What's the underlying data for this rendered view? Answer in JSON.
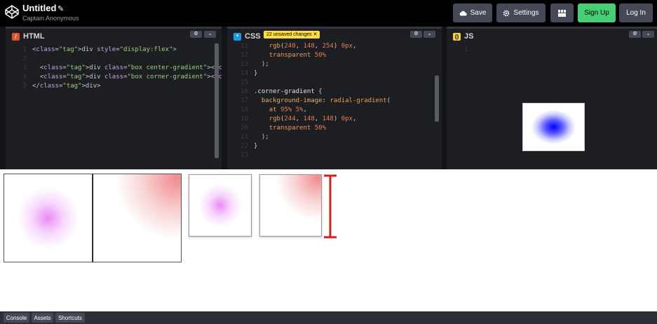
{
  "header": {
    "title": "Untitled",
    "subtitle": "Captain Anonymous",
    "buttons": {
      "save": "Save",
      "settings": "Settings",
      "signup": "Sign Up",
      "login": "Log In"
    }
  },
  "editors": {
    "html": {
      "label": "HTML",
      "lines": [
        {
          "n": "1",
          "t": "<div style=\"display:flex\">"
        },
        {
          "n": "2",
          "t": ""
        },
        {
          "n": "3",
          "t": "  <div class=\"box center-gradient\"></div>"
        },
        {
          "n": "4",
          "t": "  <div class=\"box corner-gradient\"></div>"
        },
        {
          "n": "5",
          "t": "</div>"
        }
      ]
    },
    "css": {
      "label": "CSS",
      "badge": "22 unsaved changes ✕",
      "lines": [
        {
          "n": "11",
          "t": "    rgb(240, 148, 254) 0px,"
        },
        {
          "n": "12",
          "t": "    transparent 50%"
        },
        {
          "n": "13",
          "t": "  );"
        },
        {
          "n": "14",
          "t": "}"
        },
        {
          "n": "15",
          "t": ""
        },
        {
          "n": "16",
          "t": ".corner-gradient {"
        },
        {
          "n": "17",
          "t": "  background-image: radial-gradient("
        },
        {
          "n": "18",
          "t": "    at 95% 5%,"
        },
        {
          "n": "19",
          "t": "    rgb(244, 148, 148) 0px,"
        },
        {
          "n": "20",
          "t": "    transparent 50%"
        },
        {
          "n": "21",
          "t": "  );"
        },
        {
          "n": "22",
          "t": "}"
        },
        {
          "n": "23",
          "t": ""
        }
      ]
    },
    "js": {
      "label": "JS",
      "lines": [
        {
          "n": "1",
          "t": ""
        }
      ]
    }
  },
  "footer": {
    "console": "Console",
    "assets": "Assets",
    "shortcuts": "Shortcuts"
  },
  "colors": {
    "accent_green": "#47cf73",
    "html_icon": "#e2512e",
    "css_icon": "#1a9be6",
    "js_icon": "#f5d13b",
    "unsaved_badge": "#ffdd40",
    "marker_red": "#d42020"
  }
}
